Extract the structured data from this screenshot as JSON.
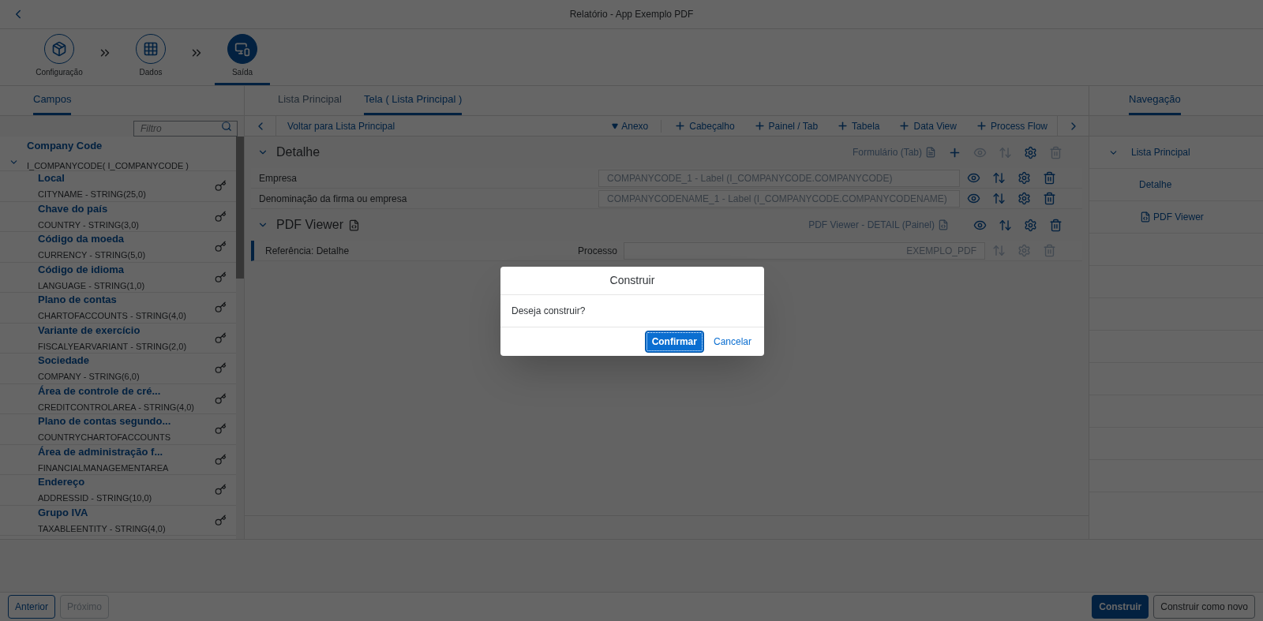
{
  "window": {
    "title": "Relatório - App Exemplo PDF"
  },
  "steps": [
    {
      "label": "Configuração",
      "selected": false
    },
    {
      "label": "Dados",
      "selected": false
    },
    {
      "label": "Saída",
      "selected": true
    }
  ],
  "fields_panel": {
    "tab": {
      "label": "Campos",
      "selected": true
    },
    "filter": {
      "placeholder": "Filtro"
    },
    "tree": {
      "label": "Company Code",
      "subtitle": "I_COMPANYCODE( I_COMPANYCODE )",
      "expanded": true,
      "children": [
        {
          "name": "Local",
          "type": "CITYNAME - STRING(25,0)"
        },
        {
          "name": "Chave do país",
          "type": "COUNTRY - STRING(3,0)"
        },
        {
          "name": "Código da moeda",
          "type": "CURRENCY - STRING(5,0)"
        },
        {
          "name": "Código de idioma",
          "type": "LANGUAGE - STRING(1,0)"
        },
        {
          "name": "Plano de contas",
          "type": "CHARTOFACCOUNTS - STRING(4,0)"
        },
        {
          "name": "Variante de exercício",
          "type": "FISCALYEARVARIANT - STRING(2,0)"
        },
        {
          "name": "Sociedade",
          "type": "COMPANY - STRING(6,0)"
        },
        {
          "name": "Área de controle de cré...",
          "type": "CREDITCONTROLAREA - STRING(4,0)"
        },
        {
          "name": "Plano de contas segundo...",
          "type": "COUNTRYCHARTOFACCOUNTS"
        },
        {
          "name": "Área de administração f...",
          "type": "FINANCIALMANAGEMENTAREA"
        },
        {
          "name": "Endereço",
          "type": "ADDRESSID - STRING(10,0)"
        },
        {
          "name": "Grupo IVA",
          "type": "TAXABLEENTITY - STRING(4,0)"
        }
      ]
    }
  },
  "center_tabs": [
    {
      "label": "Lista Principal",
      "selected": false
    },
    {
      "label": "Tela ( Lista Principal )",
      "selected": true
    }
  ],
  "toolbar": {
    "back_label": "Voltar para Lista Principal",
    "actions": [
      {
        "label": "Anexo",
        "kind": "dropdown"
      },
      {
        "label": "Cabeçalho",
        "kind": "add"
      },
      {
        "label": "Painel / Tab",
        "kind": "add"
      },
      {
        "label": "Tabela",
        "kind": "add"
      },
      {
        "label": "Data View",
        "kind": "add"
      },
      {
        "label": "Process Flow",
        "kind": "add"
      }
    ]
  },
  "sections": [
    {
      "title": "Detalhe",
      "kind": "form",
      "expanded": true,
      "type_label": "Formulário (Tab)",
      "actions": [
        {
          "kind": "add",
          "disabled": false
        },
        {
          "kind": "view",
          "disabled": true
        },
        {
          "kind": "sort",
          "disabled": true
        },
        {
          "kind": "settings",
          "disabled": false
        },
        {
          "kind": "delete",
          "disabled": true
        }
      ],
      "rows": [
        {
          "label": "Empresa",
          "value": "COMPANYCODE_1 - Label (I_COMPANYCODE.COMPANYCODE)",
          "selected": false,
          "actions": [
            {
              "kind": "view",
              "disabled": false
            },
            {
              "kind": "sort",
              "disabled": false
            },
            {
              "kind": "settings",
              "disabled": false
            },
            {
              "kind": "delete",
              "disabled": false
            }
          ]
        },
        {
          "label": "Denominação da firma ou empresa",
          "value": "COMPANYCODENAME_1 - Label (I_COMPANYCODE.COMPANYCODENAME)",
          "selected": false,
          "actions": [
            {
              "kind": "view",
              "disabled": false
            },
            {
              "kind": "sort",
              "disabled": false
            },
            {
              "kind": "settings",
              "disabled": false
            },
            {
              "kind": "delete",
              "disabled": false
            }
          ]
        }
      ]
    },
    {
      "title": "PDF Viewer",
      "kind": "pdf",
      "expanded": true,
      "type_label": "PDF Viewer - DETAIL (Painel)",
      "actions": [
        {
          "kind": "view",
          "disabled": false
        },
        {
          "kind": "sort",
          "disabled": false
        },
        {
          "kind": "settings",
          "disabled": false
        },
        {
          "kind": "delete",
          "disabled": false
        }
      ],
      "rows": [
        {
          "label": "Referência: Detalhe",
          "field_label": "Processo",
          "value": "EXEMPLO_PDF",
          "selected": true,
          "actions": [
            {
              "kind": "sort",
              "disabled": true
            },
            {
              "kind": "settings",
              "disabled": true
            },
            {
              "kind": "delete",
              "disabled": true
            }
          ]
        }
      ]
    }
  ],
  "navigation": {
    "tab": {
      "label": "Navegação",
      "selected": true
    },
    "items": [
      {
        "label": "Lista Principal",
        "expanded": true,
        "children": [
          {
            "label": "Detalhe",
            "kind": "form"
          },
          {
            "label": "PDF Viewer",
            "kind": "pdf"
          }
        ]
      }
    ]
  },
  "dialog": {
    "title": "Construir",
    "message": "Deseja construir?",
    "buttons": [
      {
        "label": "Confirmar",
        "kind": "primary"
      },
      {
        "label": "Cancelar",
        "kind": "plain"
      }
    ]
  },
  "footer": {
    "left": [
      {
        "label": "Anterior",
        "disabled": false
      },
      {
        "label": "Próximo",
        "disabled": true
      }
    ],
    "right": [
      {
        "label": "Construir",
        "kind": "primary"
      },
      {
        "label": "Construir como novo",
        "kind": "default"
      }
    ]
  }
}
